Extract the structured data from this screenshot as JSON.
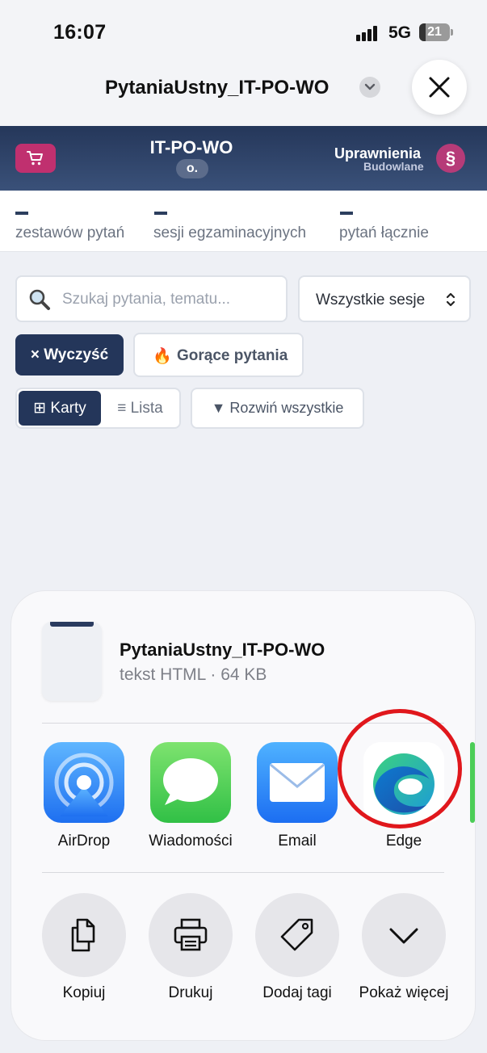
{
  "status": {
    "time": "16:07",
    "network": "5G",
    "battery": "21",
    "battery_level": 0.21
  },
  "nav": {
    "title": "PytaniaUstny_IT-PO-WO"
  },
  "app_header": {
    "title": "IT-PO-WO",
    "subtitle": "o.",
    "brand_line1": "Uprawnienia",
    "brand_line2": "Budowlane",
    "brand_mark": "§"
  },
  "stats": [
    {
      "value": "–",
      "label": "zestawów pytań"
    },
    {
      "value": "–",
      "label": "sesji egzaminacyjnych"
    },
    {
      "value": "–",
      "label": "pytań łącznie"
    }
  ],
  "search": {
    "placeholder": "Szukaj pytania, tematu..."
  },
  "session_select": {
    "value": "Wszystkie sesje"
  },
  "buttons": {
    "clear": "× Wyczyść",
    "hot_icon": "🔥",
    "hot": "Gorące pytania",
    "view_cards": "⊞ Karty",
    "view_list": "≡ Lista",
    "expand_all": "▼ Rozwiń wszystkie"
  },
  "share": {
    "file_name": "PytaniaUstny_IT-PO-WO",
    "file_meta": "tekst HTML · 64 KB",
    "apps": [
      {
        "label": "AirDrop",
        "icon": "airdrop-icon"
      },
      {
        "label": "Wiadomości",
        "icon": "messages-icon"
      },
      {
        "label": "Email",
        "icon": "mail-icon"
      },
      {
        "label": "Edge",
        "icon": "edge-icon"
      }
    ],
    "actions": [
      {
        "label": "Kopiuj",
        "icon": "copy-icon"
      },
      {
        "label": "Drukuj",
        "icon": "printer-icon"
      },
      {
        "label": "Dodaj tagi",
        "icon": "tag-icon"
      },
      {
        "label": "Pokaż więcej",
        "icon": "chevron-down-icon"
      }
    ]
  },
  "colors": {
    "header_navy": "#25375a",
    "accent_pink": "#c0306f",
    "highlight_ring": "#e0171c"
  }
}
